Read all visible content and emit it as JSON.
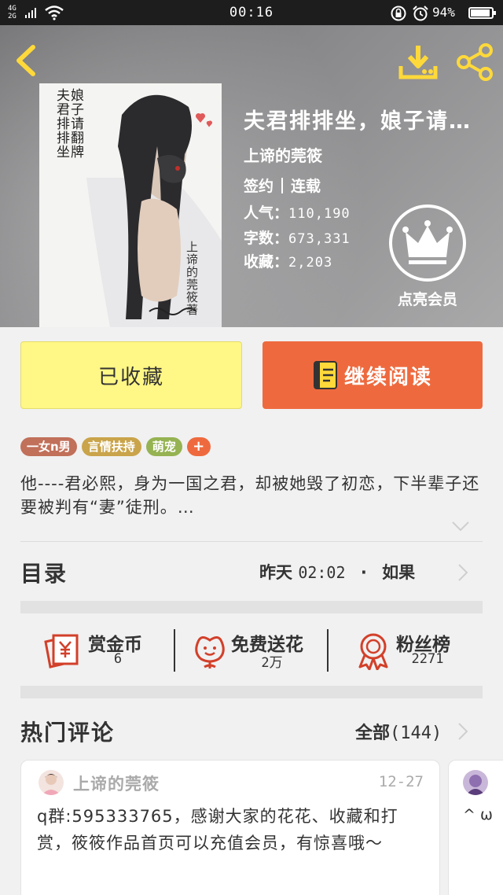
{
  "status_bar": {
    "network_top": "4G",
    "network_bottom": "2G",
    "time": "00:16",
    "battery": "94%",
    "battery_level": 0.94
  },
  "header": {
    "back_icon": "back-arrow-icon",
    "download_icon": "download-icon",
    "share_icon": "share-icon",
    "accent_color": "#ffd93a"
  },
  "cover": {
    "title_col1": "夫君排排坐",
    "title_col2": "娘子请翻牌",
    "author_col": "上谛的莞筱著"
  },
  "book": {
    "title": "夫君排排坐，娘子请…",
    "author": "上谛的莞筱",
    "contract": "签约",
    "status": "连载",
    "popularity_label": "人气：",
    "popularity": "110,190",
    "words_label": "字数：",
    "words": "673,331",
    "collections_label": "收藏：",
    "collections": "2,203"
  },
  "vip": {
    "icon": "crown-icon",
    "label": "点亮会员"
  },
  "actions": {
    "collected_label": "已收藏",
    "read_label": "继续阅读",
    "read_icon": "book-icon"
  },
  "tags": [
    {
      "label": "一女n男",
      "color": "#c1705a"
    },
    {
      "label": "言情扶持",
      "color": "#caa44a"
    },
    {
      "label": "萌宠",
      "color": "#95b352"
    },
    {
      "label": "+",
      "color": "#ee6a3e"
    }
  ],
  "summary": {
    "text": "他----君必熙，身为一国之君，却被她毁了初恋，下半辈子还要被判有“妻”徒刑。…"
  },
  "catalog": {
    "label": "目录",
    "day": "昨天",
    "time": "02:02",
    "dot": "·",
    "chapter": "如果"
  },
  "stats": [
    {
      "label": "赏金币",
      "value": "6",
      "icon": "reward-coin-icon"
    },
    {
      "label": "免费送花",
      "value": "2万",
      "icon": "flower-icon"
    },
    {
      "label": "粉丝榜",
      "value": "2271",
      "icon": "fan-rank-icon"
    }
  ],
  "comments": {
    "title": "热门评论",
    "all_label": "全部",
    "count": "(144)",
    "items": [
      {
        "user": "上谛的莞筱",
        "date": "12-27",
        "text": "q群:595333765，感谢大家的花花、收藏和打赏，筱筱作品首页可以充值会员，有惊喜哦～"
      },
      {
        "snippet": "^ ω"
      }
    ]
  }
}
